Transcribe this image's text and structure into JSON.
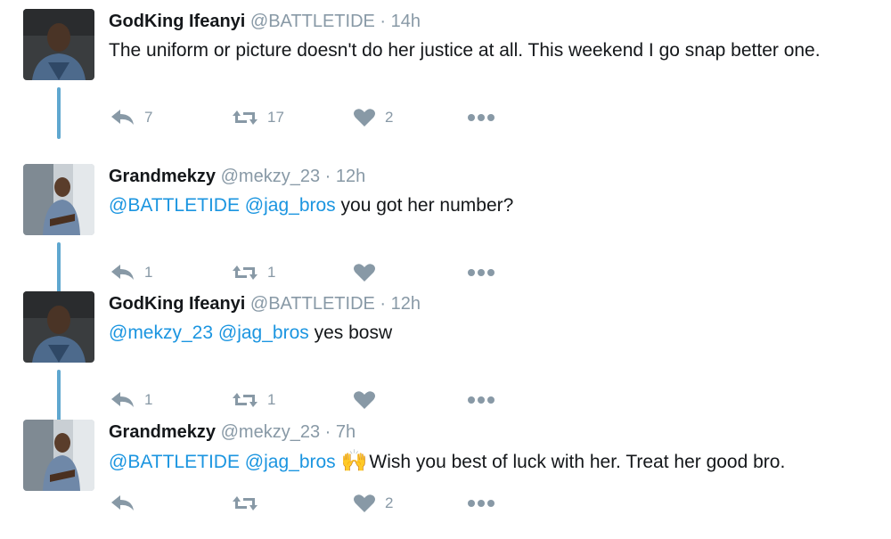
{
  "tweets": [
    {
      "name": "GodKing Ifeanyi",
      "handle": "@BATTLETIDE",
      "separator": "·",
      "time": "14h",
      "text": "The uniform or picture doesn't do her justice at all. This weekend I go snap better one.",
      "mentions": [],
      "emoji": "",
      "replies": "7",
      "retweets": "17",
      "likes": "2",
      "avatar": "avatar-ifeanyi"
    },
    {
      "name": "Grandmekzy",
      "handle": "@mekzy_23",
      "separator": "·",
      "time": "12h",
      "text": "you got her number?",
      "mentions": [
        "@BATTLETIDE",
        "@jag_bros"
      ],
      "emoji": "",
      "replies": "1",
      "retweets": "1",
      "likes": "",
      "avatar": "avatar-mekzy"
    },
    {
      "name": "GodKing Ifeanyi",
      "handle": "@BATTLETIDE",
      "separator": "·",
      "time": "12h",
      "text": "yes bosw",
      "mentions": [
        "@mekzy_23",
        "@jag_bros"
      ],
      "emoji": "",
      "replies": "1",
      "retweets": "1",
      "likes": "",
      "avatar": "avatar-ifeanyi"
    },
    {
      "name": "Grandmekzy",
      "handle": "@mekzy_23",
      "separator": "·",
      "time": "7h",
      "text": "Wish you best of luck with her. Treat her good bro.",
      "mentions": [
        "@BATTLETIDE",
        "@jag_bros"
      ],
      "emoji": "🙌",
      "replies": "",
      "retweets": "",
      "likes": "2",
      "avatar": "avatar-mekzy"
    }
  ],
  "icons": {
    "reply": "reply-icon",
    "retweet": "retweet-icon",
    "like": "heart-icon",
    "more": "more-dots-icon"
  },
  "colors": {
    "name": "#14171a",
    "muted": "#8899a6",
    "mention": "#1b95e0",
    "thread_line": "#5fa7cf"
  }
}
